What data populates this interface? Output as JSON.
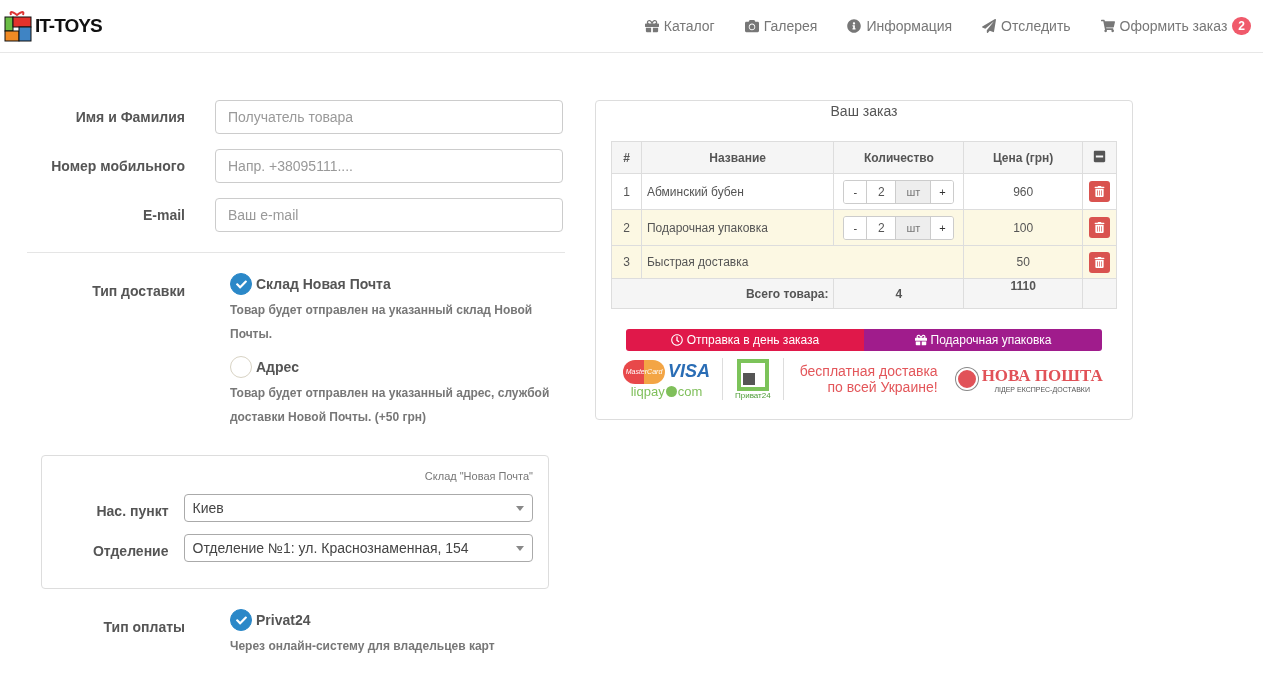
{
  "header": {
    "logo": "IT-TOYS",
    "nav": [
      {
        "kind": "gift",
        "label": "Каталог"
      },
      {
        "kind": "camera",
        "label": "Галерея"
      },
      {
        "kind": "info",
        "label": "Информация"
      },
      {
        "kind": "send",
        "label": "Отследить"
      },
      {
        "kind": "cart",
        "label": "Оформить заказ",
        "badge": "2"
      }
    ]
  },
  "contact_form": {
    "fields": [
      {
        "label": "Имя и Фамилия",
        "placeholder": "Получатель товара"
      },
      {
        "label": "Номер мобильного",
        "placeholder": "Напр. +38095111...."
      },
      {
        "label": "E-mail",
        "placeholder": "Ваш e-mail"
      }
    ]
  },
  "delivery": {
    "label": "Тип доставки",
    "options": [
      {
        "title": "Склад Новая Почта",
        "description": "Товар будет отправлен на указанный склад Новой Почты.",
        "selected": true
      },
      {
        "title": "Адрес",
        "description": "Товар будет отправлен на указанный адрес, службой доставки Новой Почты. (+50 грн)",
        "selected": false
      }
    ]
  },
  "warehouse": {
    "caption": "Склад \"Новая Почта\"",
    "selects": [
      {
        "label": "Нас. пункт",
        "value": "Киев"
      },
      {
        "label": "Отделение",
        "value": "Отделение №1: ул. Краснознаменная, 154"
      }
    ]
  },
  "payment": {
    "label": "Тип оплаты",
    "options": [
      {
        "title": "Privat24",
        "description": "Через онлайн-систему для владельцев карт",
        "selected": true
      }
    ]
  },
  "order": {
    "title": "Ваш заказ",
    "columns": [
      "#",
      "Название",
      "Количество",
      "Цена (грн)"
    ],
    "rows": [
      {
        "kind": "product",
        "index": "1",
        "name": "Абминский бубен",
        "decrement": "-",
        "quantity": "2",
        "unit": "шт",
        "increment": "+",
        "price": "960",
        "highlighted": false
      },
      {
        "kind": "product",
        "index": "2",
        "name": "Подарочная упаковка",
        "decrement": "-",
        "quantity": "2",
        "unit": "шт",
        "increment": "+",
        "price": "100",
        "highlighted": true
      },
      {
        "kind": "service",
        "index": "3",
        "name": "Быстрая доставка",
        "price": "50",
        "highlighted": true
      }
    ],
    "total": {
      "label": "Всего товара:",
      "quantity": "4",
      "price": "1110"
    },
    "badges": [
      {
        "kind": "clock",
        "label": "Отправка в день заказа",
        "color": "#e0184a"
      },
      {
        "kind": "gift",
        "label": "Подарочная упаковка",
        "color": "#a01c8c"
      }
    ],
    "banner": {
      "mastercard": "MasterCard",
      "visa": "VISA",
      "liqpay": "liqpay",
      "liqpay_suffix": "com",
      "privat": "Приват24",
      "free_delivery": [
        "бесплатная доставка",
        "по всей Украине!"
      ],
      "nova_poshta": "НОВА ПОШТА",
      "nova_poshta_tagline": "ЛІДЕР ЕКСПРЕС-ДОСТАВКИ"
    }
  }
}
